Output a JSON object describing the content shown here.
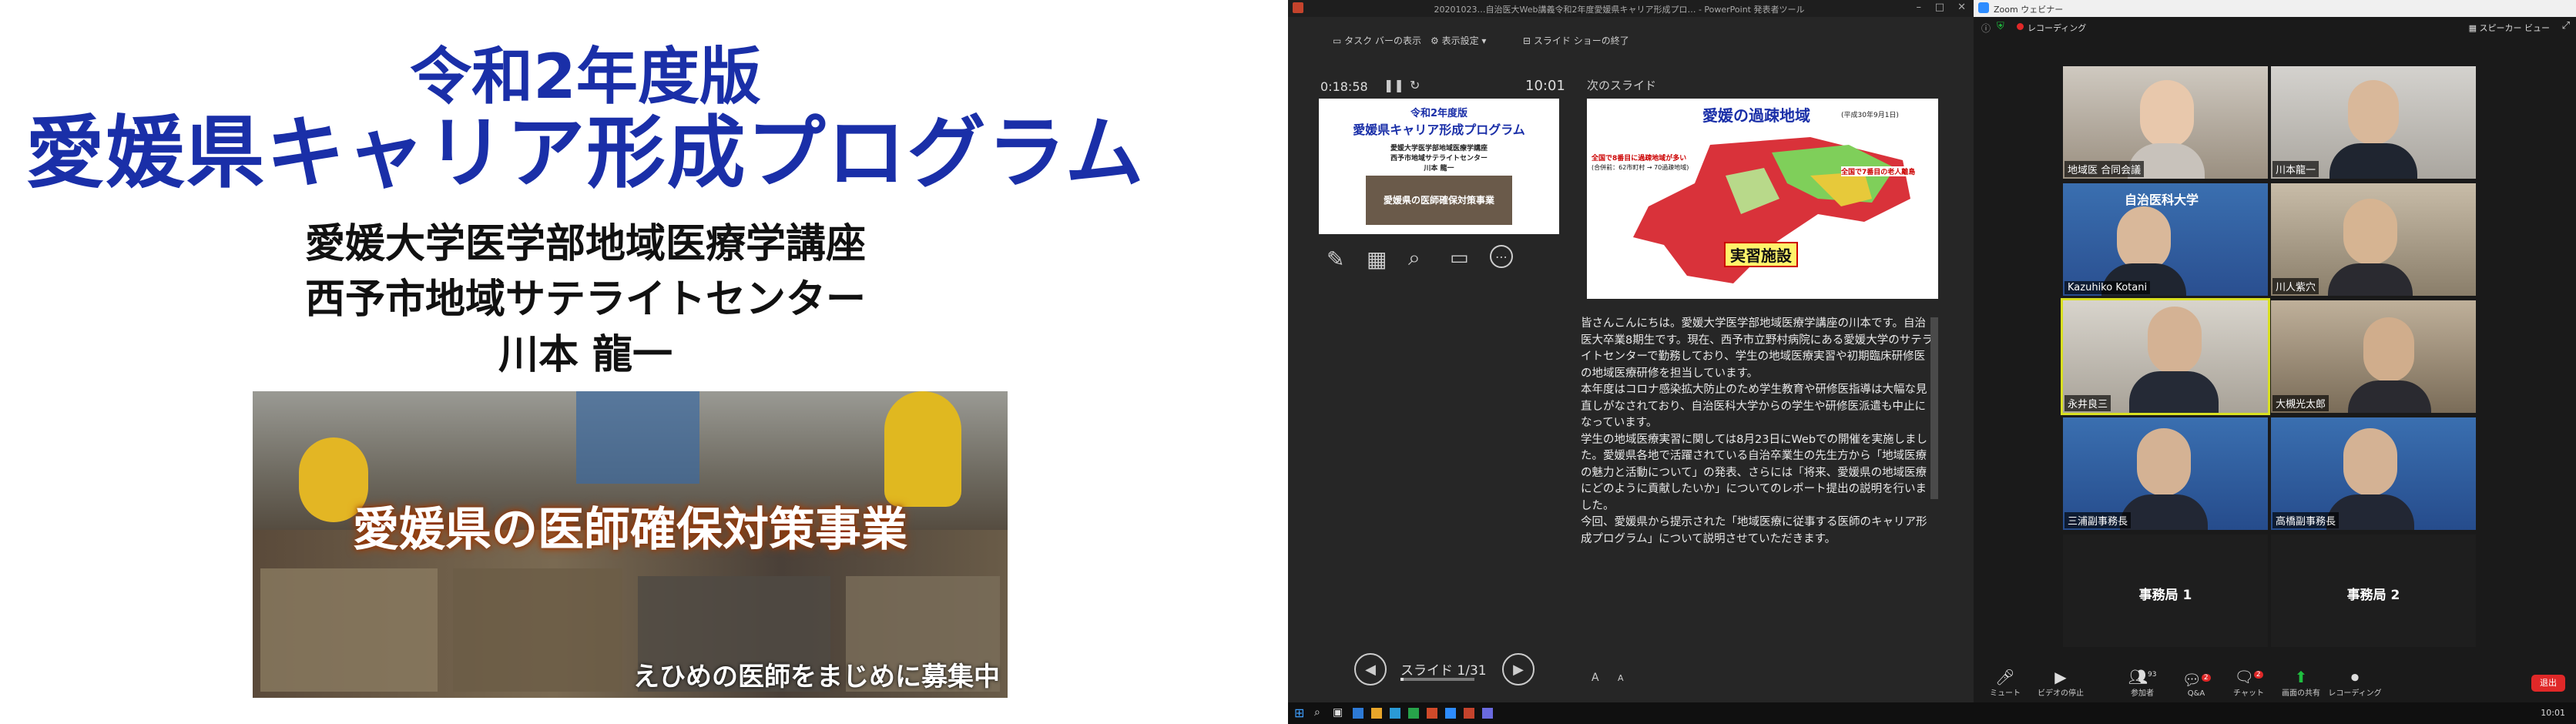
{
  "slide": {
    "title_line1": "令和2年度版",
    "title_line2": "愛媛県キャリア形成プログラム",
    "org_line1": "愛媛大学医学部地域医療学講座",
    "org_line2": "西予市地域サテライトセンター",
    "presenter": "川本 龍一",
    "photo_banner": "愛媛県の医師確保対策事業",
    "photo_recruit": "えひめの医師をまじめに募集中"
  },
  "presenter_view": {
    "window_title": "20201023…自治医大Web講義令和2年度愛媛県キャリア形成プロ… - PowerPoint 発表者ツール",
    "toolbar": [
      "タスク バーの表示",
      "表示設定 ▾",
      "スライド ショーの終了"
    ],
    "timer": "0:18:58",
    "clock": "10:01",
    "next_slide_label": "次のスライド",
    "thumb": {
      "line1": "令和2年度版",
      "line2": "愛媛県キャリア形成プログラム",
      "line3": "愛媛大学医学部地域医療学講座",
      "line4": "西予市地域サテライトセンター",
      "line5": "川本 龍一",
      "banner": "愛媛県の医師確保対策事業"
    },
    "next_slide": {
      "title": "愛媛の過疎地域",
      "date": "(平成30年9月1日)",
      "note1": "全国で8番目に過疎地域が多い",
      "note2": "(合併前：62市町村 → 70過疎地域)",
      "note3": "全国で7番目の老人離島",
      "facility_label": "実習施設"
    },
    "slide_counter": "スライド 1/31",
    "notes": "皆さんこんにちは。愛媛大学医学部地域医療学講座の川本です。自治医大卒業8期生です。現在、西予市立野村病院にある愛媛大学のサテライトセンターで勤務しており、学生の地域医療実習や初期臨床研修医の地域医療研修を担当しています。\n本年度はコロナ感染拡大防止のため学生教育や研修医指導は大幅な見直しがなされており、自治医科大学からの学生や研修医派遣も中止になっています。\n学生の地域医療実習に関しては8月23日にWebでの開催を実施しました。愛媛県各地で活躍されている自治卒業生の先生方から「地域医療の魅力と活動について」の発表、さらには「将来、愛媛県の地域医療にどのように貢献したいか」についてのレポート提出の説明を行いました。\n今回、愛媛県から提示された「地域医療に従事する医師のキャリア形成プログラム」について説明させていただきます。",
    "font_buttons": [
      "A",
      "A"
    ]
  },
  "zoom": {
    "window_title": "Zoom ウェビナー",
    "recording": "レコーディング",
    "speaker_view": "スピーカー ビュー",
    "participants": [
      {
        "name": "地域医 合同会議"
      },
      {
        "name": "川本龍一"
      },
      {
        "name": "Kazuhiko Kotani"
      },
      {
        "name": "川人紫穴"
      },
      {
        "name": "永井良三"
      },
      {
        "name": "大槻光太郎"
      },
      {
        "name": "三浦副事務長"
      },
      {
        "name": "高橋副事務長"
      },
      {
        "name": "事務局 1"
      },
      {
        "name": "事務局 2"
      }
    ],
    "toolbar": [
      {
        "icon": "mic-icon",
        "label": "ミュート"
      },
      {
        "icon": "video-icon",
        "label": "ビデオの停止"
      },
      {
        "icon": "participants-icon",
        "label": "参加者",
        "count": "93"
      },
      {
        "icon": "qa-icon",
        "label": "Q&A",
        "badge": "2"
      },
      {
        "icon": "chat-icon",
        "label": "チャット",
        "badge": "2"
      },
      {
        "icon": "share-screen-icon",
        "label": "画面の共有"
      },
      {
        "icon": "record-icon",
        "label": "レコーディング"
      }
    ],
    "end_label": "退出",
    "tile_label_under_sign": "自治医科大学",
    "accent": "#1fbf3f",
    "end_color": "#e02828"
  },
  "taskbar": {
    "time": "10:01"
  }
}
